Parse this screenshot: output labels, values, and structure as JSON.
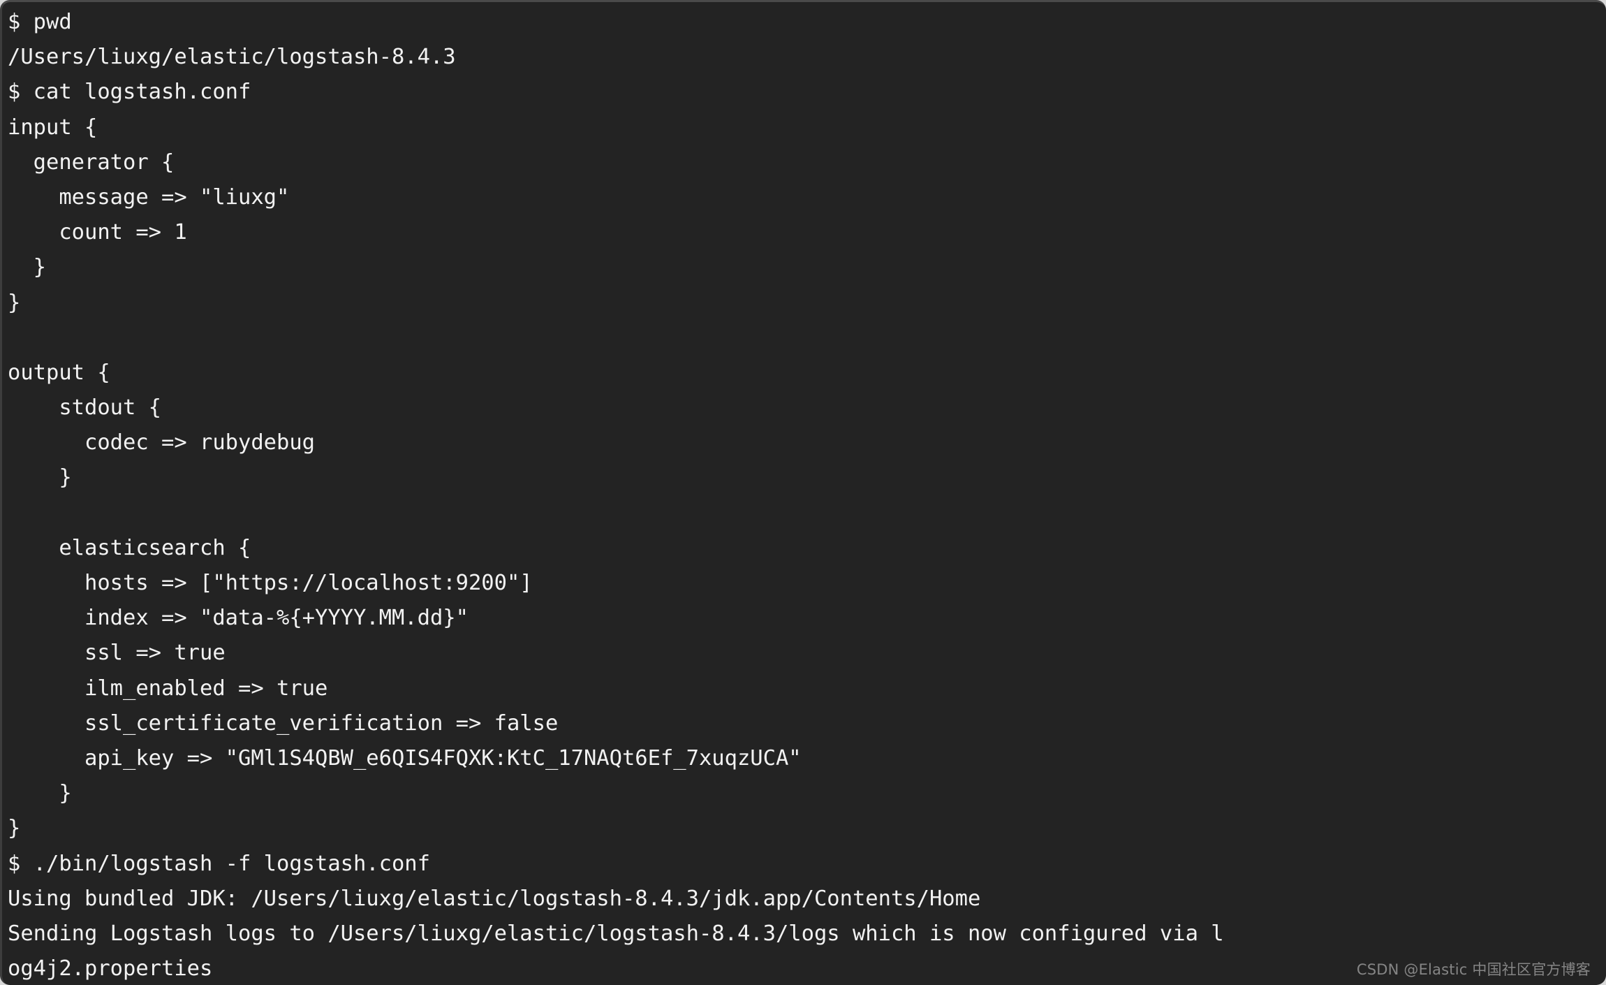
{
  "window": {
    "kind": "terminal-emulator",
    "background_color": "#232323",
    "foreground_color": "#f2f2f2",
    "page_background_color": "#d8d8d8"
  },
  "terminal": {
    "prompt_symbol": "$",
    "lines": [
      "$ pwd",
      "/Users/liuxg/elastic/logstash-8.4.3",
      "$ cat logstash.conf",
      "input {",
      "  generator {",
      "    message => \"liuxg\"",
      "    count => 1",
      "  }",
      "}",
      "",
      "output {",
      "    stdout {",
      "      codec => rubydebug",
      "    }",
      "",
      "    elasticsearch {",
      "      hosts => [\"https://localhost:9200\"]",
      "      index => \"data-%{+YYYY.MM.dd}\"",
      "      ssl => true",
      "      ilm_enabled => true",
      "      ssl_certificate_verification => false",
      "      api_key => \"GMl1S4QBW_e6QIS4FQXK:KtC_17NAQt6Ef_7xuqzUCA\"",
      "    }",
      "}",
      "$ ./bin/logstash -f logstash.conf",
      "Using bundled JDK: /Users/liuxg/elastic/logstash-8.4.3/jdk.app/Contents/Home",
      "Sending Logstash logs to /Users/liuxg/elastic/logstash-8.4.3/logs which is now configured via l",
      "og4j2.properties"
    ],
    "commands": [
      "pwd",
      "cat logstash.conf",
      "./bin/logstash -f logstash.conf"
    ],
    "working_directory": "/Users/liuxg/elastic/logstash-8.4.3",
    "config_file_name": "logstash.conf",
    "config_values": {
      "input_plugin": "generator",
      "message": "liuxg",
      "count": "1",
      "stdout_codec": "rubydebug",
      "hosts": "[\"https://localhost:9200\"]",
      "index": "data-%{+YYYY.MM.dd}",
      "ssl": "true",
      "ilm_enabled": "true",
      "ssl_certificate_verification": "false",
      "api_key": "GMl1S4QBW_e6QIS4FQXK:KtC_17NAQt6Ef_7xuqzUCA"
    },
    "run_output": {
      "jdk_line": "Using bundled JDK: /Users/liuxg/elastic/logstash-8.4.3/jdk.app/Contents/Home",
      "logs_line": "Sending Logstash logs to /Users/liuxg/elastic/logstash-8.4.3/logs which is now configured via log4j2.properties"
    }
  },
  "watermark": {
    "text": "CSDN @Elastic 中国社区官方博客",
    "color": "#8e8e8e"
  }
}
